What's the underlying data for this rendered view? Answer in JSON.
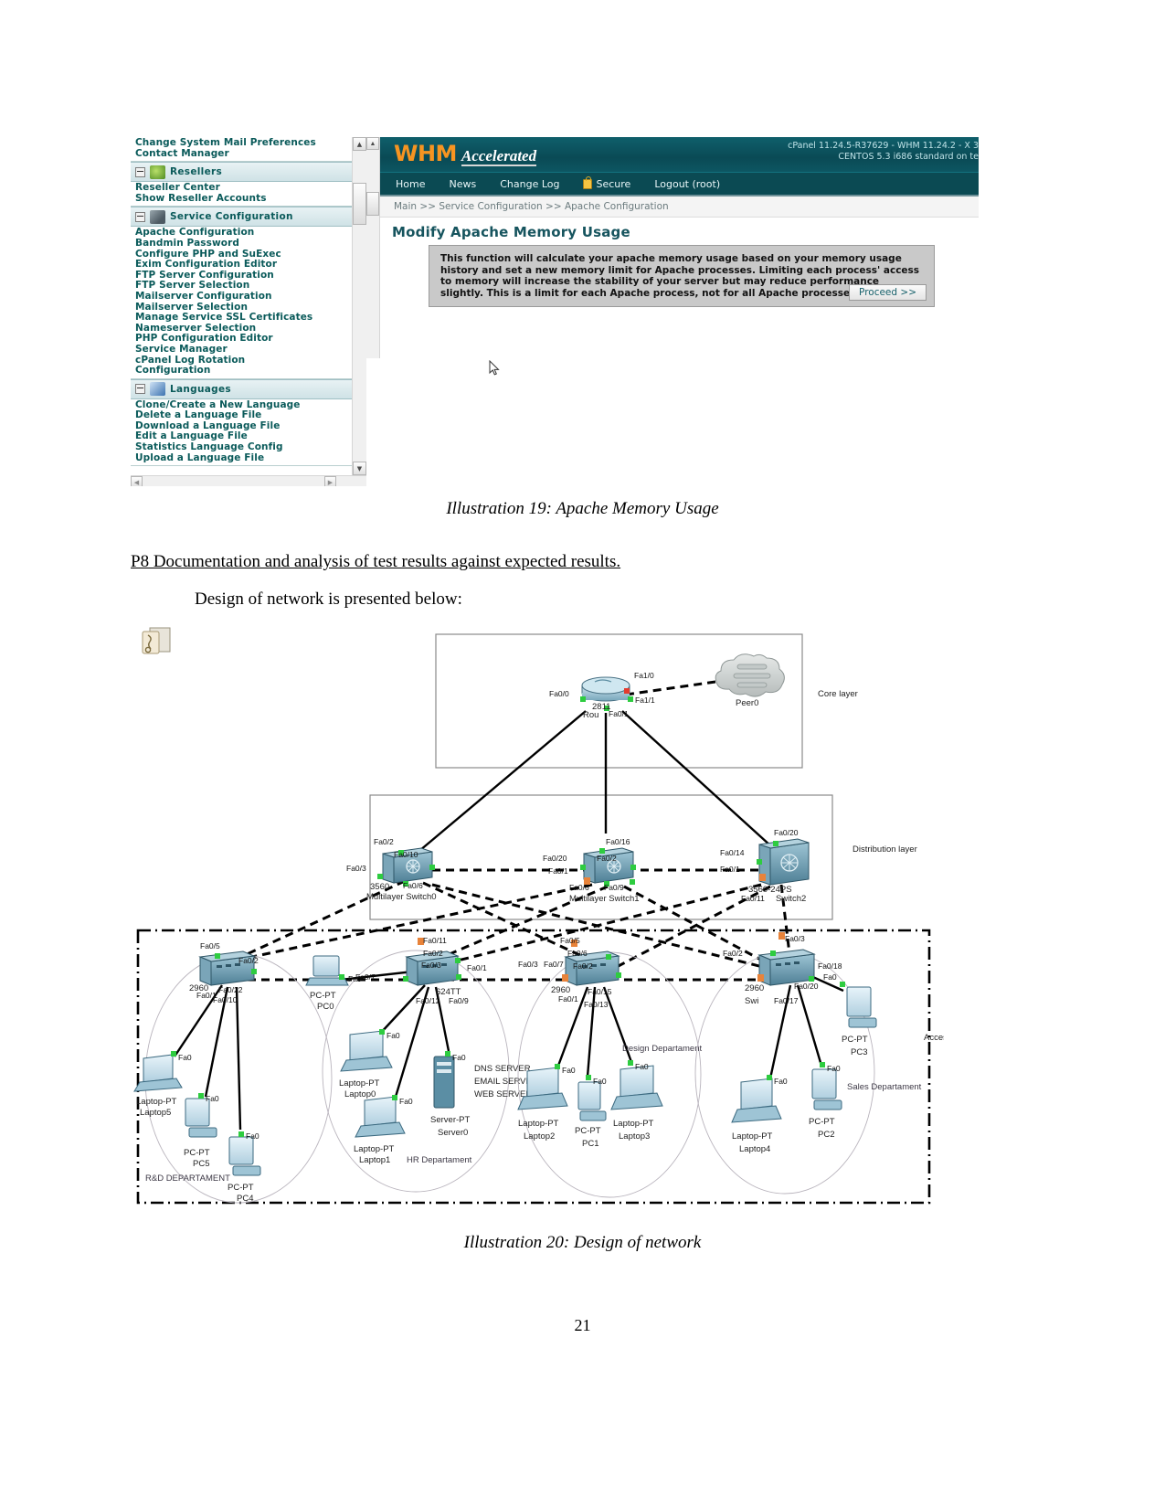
{
  "document": {
    "page_number": "21",
    "heading": "P8 Documentation and analysis of test results against expected results.",
    "paragraph": "Design of network is presented below:",
    "caption_19": "Illustration 19: Apache Memory Usage",
    "caption_20": "Illustration 20:  Design of network"
  },
  "whm": {
    "logo": "WHM",
    "logo_sub": "Accelerated",
    "version_line1": "cPanel 11.24.5-R37629 - WHM 11.24.2 - X 3",
    "version_line2": "CENTOS 5.3 i686 standard on te",
    "nav": [
      {
        "label": "Home",
        "icon": ""
      },
      {
        "label": "News",
        "icon": ""
      },
      {
        "label": "Change Log",
        "icon": ""
      },
      {
        "label": "Secure",
        "icon": "lock-icon"
      },
      {
        "label": "Logout (root)",
        "icon": ""
      }
    ],
    "breadcrumb": "Main >> Service Configuration >> Apache Configuration",
    "page_title": "Modify Apache Memory Usage",
    "notice": "This function will calculate your apache memory usage based on your memory usage history and set a new memory limit for Apache processes. Limiting each process' access to memory will increase the stability of your server but may reduce performance slightly. This is a limit for each Apache process, not for all Apache processes combined.",
    "proceed_label": "Proceed >>",
    "sidebar": {
      "top_links": [
        "Change System Mail Preferences",
        "Contact Manager"
      ],
      "sections": [
        {
          "title": "Resellers",
          "icon": "resellers-icon",
          "items": [
            "Reseller Center",
            "Show Reseller Accounts"
          ]
        },
        {
          "title": "Service Configuration",
          "icon": "service-configuration-icon",
          "items": [
            "Apache Configuration",
            "Bandmin Password",
            "Configure PHP and SuExec",
            "Exim Configuration Editor",
            "FTP Server Configuration",
            "FTP Server Selection",
            "Mailserver Configuration",
            "Mailserver Selection",
            "Manage Service SSL Certificates",
            "Nameserver Selection",
            "PHP Configuration Editor",
            "Service Manager",
            "cPanel Log Rotation",
            "Configuration"
          ]
        },
        {
          "title": "Languages",
          "icon": "languages-icon",
          "items": [
            "Clone/Create a New Language",
            "Delete a Language File",
            "Download a Language File",
            "Edit a Language File",
            "Statistics Language Config",
            "Upload a Language File"
          ]
        }
      ]
    }
  },
  "network": {
    "layer_labels": [
      {
        "id": "core",
        "label": "Core layer"
      },
      {
        "id": "distribution",
        "label": "Distribution layer"
      },
      {
        "id": "access",
        "label": "Access"
      }
    ],
    "core": {
      "router": {
        "model": "2811",
        "name": "Rou",
        "ports": [
          "Fa1/0",
          "Fa0/0",
          "Fa1/1",
          "Fa0/1"
        ]
      },
      "peer": {
        "name": "Peer0"
      }
    },
    "distribution": [
      {
        "name": "Multilayer Switch0",
        "model": "3560",
        "ports": [
          "Fa0/2",
          "Fa0/10",
          "Fa0/3",
          "Fa0/6"
        ]
      },
      {
        "name": "Multilayer Switch1",
        "model": "",
        "ports": [
          "Fa0/16",
          "Fa0/2",
          "Fa0/20",
          "Fa0/1",
          "Fa0/6",
          "Fa0/9"
        ]
      },
      {
        "name": "Switch2",
        "model": "3560-24PS",
        "ports": [
          "Fa0/20",
          "Fa0/14",
          "Fa0/1",
          "Fa0/11"
        ]
      }
    ],
    "access": [
      {
        "department": "R&D DEPARTAMENT",
        "switch": {
          "name": "2960",
          "ports": [
            "Fa0/5",
            "Fa0/2",
            "Fa0/1",
            "Fa0/22",
            "Fa0/10"
          ]
        },
        "devices": [
          {
            "type": "Laptop-PT",
            "name": "Laptop5",
            "port": "Fa0"
          },
          {
            "type": "PC-PT",
            "name": "PC5",
            "port": "Fa0"
          },
          {
            "type": "PC-PT",
            "name": "PC4",
            "port": "Fa0"
          }
        ]
      },
      {
        "department": "HR Departament",
        "switch": {
          "name": "624TT",
          "ports": [
            "Fa0/11",
            "Fa0/2",
            "Fa0/3",
            "Fa0/1",
            "Fa0/7",
            "Fa0/12",
            "Fa0/9"
          ]
        },
        "devices": [
          {
            "type": "PC-PT",
            "name": "PC0",
            "port": "Fa0"
          },
          {
            "type": "Laptop-PT",
            "name": "Laptop0",
            "port": "Fa0"
          },
          {
            "type": "Laptop-PT",
            "name": "Laptop1",
            "port": "Fa0"
          },
          {
            "type": "Server-PT",
            "name": "Server0",
            "port": "Fa0",
            "roles": [
              "DNS SERVER",
              "EMAIL SERVER",
              "WEB SERVER"
            ]
          }
        ]
      },
      {
        "department": "Design Departament",
        "switch": {
          "name": "2960",
          "ports": [
            "Fa0/5",
            "Fa0/6",
            "Fa0/3",
            "Fa0/7",
            "Fa0/2",
            "Fa0/1",
            "Fa0/15",
            "Fa0/13"
          ]
        },
        "devices": [
          {
            "type": "Laptop-PT",
            "name": "Laptop2",
            "port": "Fa0"
          },
          {
            "type": "PC-PT",
            "name": "PC1",
            "port": "Fa0"
          },
          {
            "type": "Laptop-PT",
            "name": "Laptop3",
            "port": "Fa0"
          }
        ]
      },
      {
        "department": "Sales Departament",
        "switch": {
          "name": "2960",
          "label": "Swi",
          "ports": [
            "Fa0/3",
            "Fa0/2",
            "Fa0/18",
            "Fa0/20",
            "Fa0/17"
          ]
        },
        "devices": [
          {
            "type": "PC-PT",
            "name": "PC3",
            "port": "Fa0"
          },
          {
            "type": "Laptop-PT",
            "name": "Laptop4",
            "port": "Fa0"
          },
          {
            "type": "PC-PT",
            "name": "PC2",
            "port": "Fa0"
          }
        ]
      }
    ]
  }
}
